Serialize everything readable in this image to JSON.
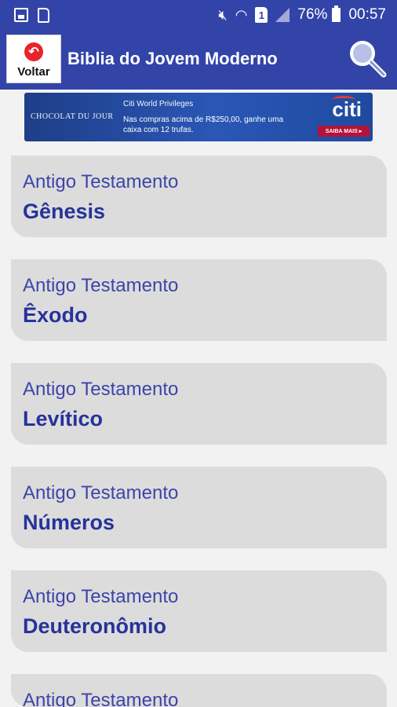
{
  "status_bar": {
    "battery": "76%",
    "time": "00:57",
    "sim_slot": "1"
  },
  "app_bar": {
    "back_label": "Voltar",
    "title": "Biblia do Jovem Moderno",
    "back_icon": "back-arrow-icon",
    "search_icon": "magnifier-icon"
  },
  "ad": {
    "brand": "CHOCOLAT DU JOUR",
    "sponsor_line": "Citi World Privileges",
    "text": "Nas compras acima de R$250,00, ganhe uma caixa com 12 trufas.",
    "logo": "citi",
    "cta": "SAIBA MAIS ▸"
  },
  "books": [
    {
      "testament": "Antigo Testamento",
      "name": "Gênesis"
    },
    {
      "testament": "Antigo Testamento",
      "name": "Êxodo"
    },
    {
      "testament": "Antigo Testamento",
      "name": "Levítico"
    },
    {
      "testament": "Antigo Testamento",
      "name": "Números"
    },
    {
      "testament": "Antigo Testamento",
      "name": "Deuteronômio"
    },
    {
      "testament": "Antigo Testamento",
      "name": ""
    }
  ],
  "colors": {
    "primary": "#3344a8",
    "card": "#dcdcdc",
    "testament_text": "#3d44a8",
    "book_text": "#27329a",
    "back_red": "#e8232a"
  }
}
